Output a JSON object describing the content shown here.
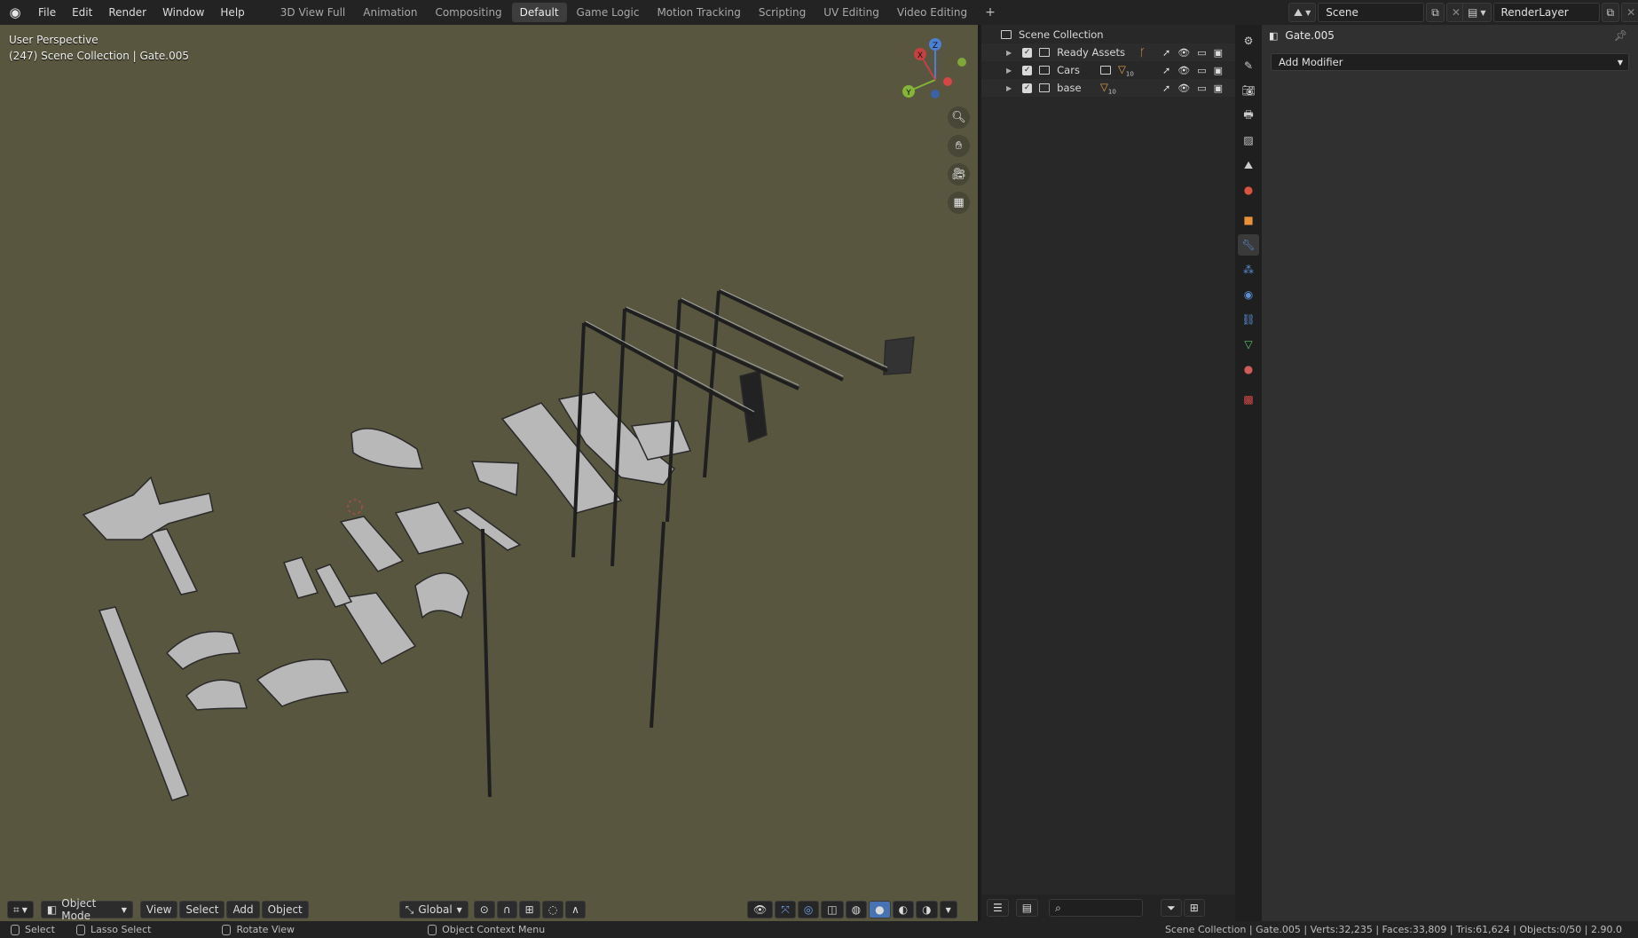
{
  "menu": [
    "File",
    "Edit",
    "Render",
    "Window",
    "Help"
  ],
  "workspace_tabs": [
    "3D View Full",
    "Animation",
    "Compositing",
    "Default",
    "Game Logic",
    "Motion Tracking",
    "Scripting",
    "UV Editing",
    "Video Editing"
  ],
  "active_tab": "Default",
  "scene": {
    "name": "Scene",
    "render_layer": "RenderLayer"
  },
  "viewport": {
    "perspective": "User Perspective",
    "context": "(247) Scene Collection | Gate.005",
    "background_color": "#59563f",
    "gizmo_axes": {
      "x": "X",
      "y": "Y",
      "z": "Z"
    },
    "header": {
      "mode": "Object Mode",
      "menus": [
        "View",
        "Select",
        "Add",
        "Object"
      ],
      "orientation": "Global"
    }
  },
  "outliner": {
    "root": "Scene Collection",
    "collections": [
      {
        "name": "Ready Assets",
        "badge": ""
      },
      {
        "name": "Cars",
        "badge": "10"
      },
      {
        "name": "base",
        "badge": "10"
      }
    ]
  },
  "properties": {
    "object_name": "Gate.005",
    "add_modifier_label": "Add Modifier"
  },
  "statusbar": {
    "select": "Select",
    "lasso": "Lasso Select",
    "rotate": "Rotate View",
    "context_menu": "Object Context Menu",
    "stats": "Scene Collection | Gate.005 | Verts:32,235 | Faces:33,809 | Tris:61,624 | Objects:0/50 | 2.90.0"
  },
  "colors": {
    "accent": "#4772b3",
    "active_tab_bg": "#3d3d3d",
    "modifier_icon": "#5b8fd6"
  }
}
